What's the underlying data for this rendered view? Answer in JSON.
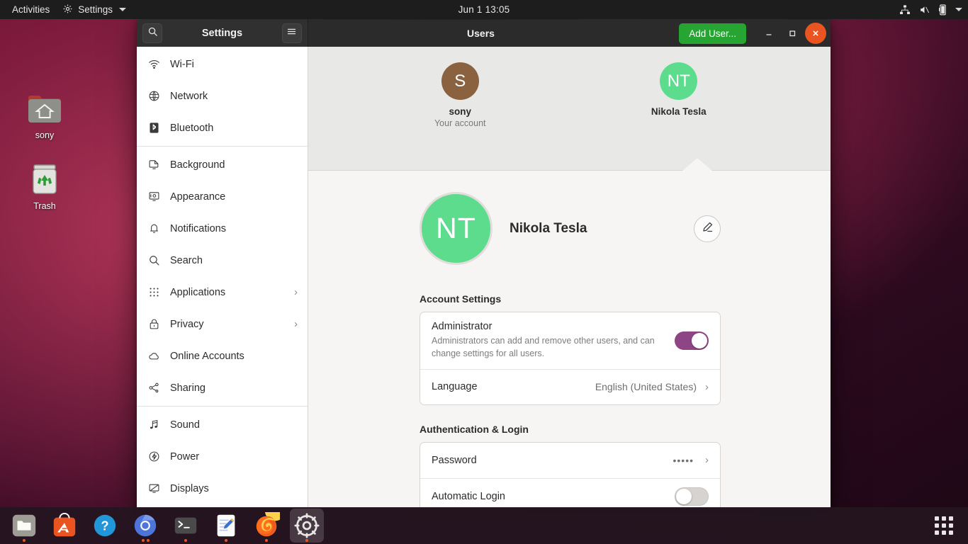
{
  "topbar": {
    "activities": "Activities",
    "app_menu": "Settings",
    "clock": "Jun 1  13:05",
    "icons": [
      "network-icon",
      "volume-muted-icon",
      "battery-icon",
      "caret-down-icon"
    ]
  },
  "desktop": {
    "icons": [
      {
        "label": "sony",
        "icon": "home-folder-icon"
      },
      {
        "label": "Trash",
        "icon": "trash-icon"
      }
    ]
  },
  "window": {
    "sidebar_title": "Settings",
    "title": "Users",
    "add_user_label": "Add User...",
    "controls": {
      "minimize": "–",
      "maximize": "□",
      "close": "×"
    }
  },
  "sidebar": {
    "groups": [
      [
        {
          "label": "Wi-Fi",
          "icon": "wifi-icon",
          "chevron": false
        },
        {
          "label": "Network",
          "icon": "globe-icon",
          "chevron": false
        },
        {
          "label": "Bluetooth",
          "icon": "bluetooth-icon",
          "chevron": false
        }
      ],
      [
        {
          "label": "Background",
          "icon": "background-icon",
          "chevron": false
        },
        {
          "label": "Appearance",
          "icon": "appearance-icon",
          "chevron": false
        },
        {
          "label": "Notifications",
          "icon": "bell-icon",
          "chevron": false
        },
        {
          "label": "Search",
          "icon": "search-icon",
          "chevron": false
        },
        {
          "label": "Applications",
          "icon": "apps-grid-icon",
          "chevron": true
        },
        {
          "label": "Privacy",
          "icon": "lock-icon",
          "chevron": true
        },
        {
          "label": "Online Accounts",
          "icon": "cloud-icon",
          "chevron": false
        },
        {
          "label": "Sharing",
          "icon": "share-icon",
          "chevron": false
        }
      ],
      [
        {
          "label": "Sound",
          "icon": "music-note-icon",
          "chevron": false
        },
        {
          "label": "Power",
          "icon": "power-icon",
          "chevron": false
        },
        {
          "label": "Displays",
          "icon": "display-icon",
          "chevron": false
        }
      ]
    ]
  },
  "carousel": {
    "users": [
      {
        "initials": "S",
        "name": "sony",
        "subtitle": "Your account",
        "color": "#8a6240",
        "selected": false
      },
      {
        "initials": "NT",
        "name": "Nikola Tesla",
        "subtitle": "",
        "color": "#5ddc8e",
        "selected": true
      }
    ]
  },
  "user_panel": {
    "initials": "NT",
    "name": "Nikola Tesla",
    "avatar_color": "#5ddc8e",
    "edit_icon": "pencil-icon",
    "sections": [
      {
        "title": "Account Settings",
        "rows": [
          {
            "name": "administrator",
            "title": "Administrator",
            "subtitle": "Administrators can add and remove other users, and can change settings for all users.",
            "control": "toggle",
            "toggle_state": "on",
            "value": ""
          },
          {
            "name": "language",
            "title": "Language",
            "subtitle": "",
            "control": "value-chevron",
            "toggle_state": "",
            "value": "English (United States)"
          }
        ]
      },
      {
        "title": "Authentication & Login",
        "rows": [
          {
            "name": "password",
            "title": "Password",
            "subtitle": "",
            "control": "dots-chevron",
            "toggle_state": "",
            "value": "•••••"
          },
          {
            "name": "automatic-login",
            "title": "Automatic Login",
            "subtitle": "",
            "control": "toggle",
            "toggle_state": "off",
            "value": ""
          }
        ]
      }
    ]
  },
  "colors": {
    "accent_green": "#26a532",
    "close_orange": "#e95420",
    "toggle_on": "#8e4585"
  },
  "dock": {
    "apps": [
      {
        "name": "files",
        "icon": "files-icon",
        "running": 1,
        "active": false
      },
      {
        "name": "ubuntu-software",
        "icon": "software-icon",
        "running": 0,
        "active": false
      },
      {
        "name": "help",
        "icon": "help-icon",
        "running": 0,
        "active": false
      },
      {
        "name": "chromium",
        "icon": "chromium-icon",
        "running": 2,
        "active": false
      },
      {
        "name": "terminal",
        "icon": "terminal-icon",
        "running": 1,
        "active": false
      },
      {
        "name": "text-editor",
        "icon": "text-editor-icon",
        "running": 1,
        "active": false
      },
      {
        "name": "firefox",
        "icon": "firefox-icon",
        "running": 1,
        "active": false
      },
      {
        "name": "settings",
        "icon": "settings-gear-icon",
        "running": 1,
        "active": true
      }
    ],
    "show_apps_label": "Show Applications"
  }
}
